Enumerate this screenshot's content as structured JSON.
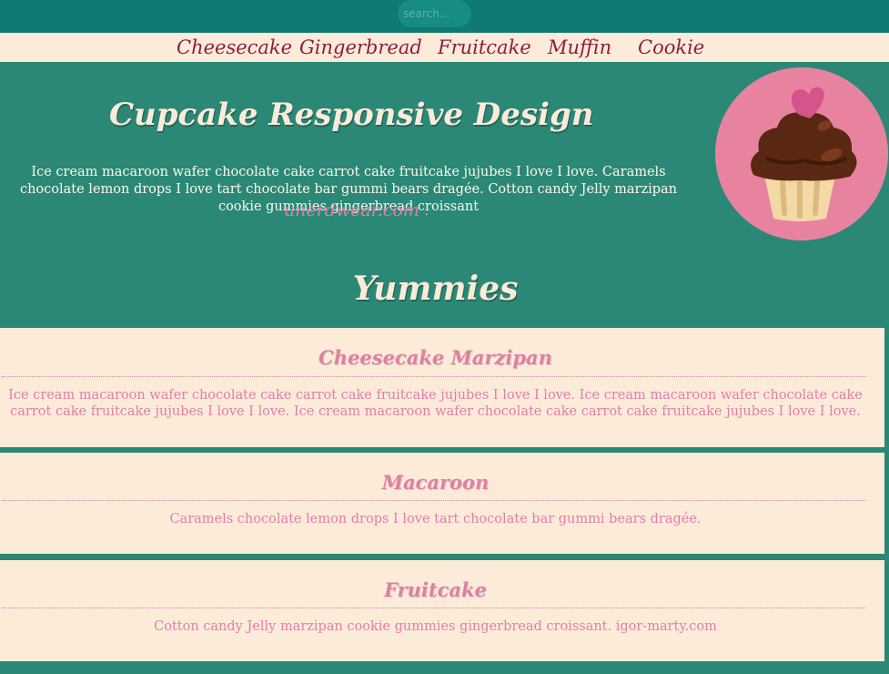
{
  "search": {
    "placeholder": "search..."
  },
  "nav": {
    "items": [
      "Cheesecake",
      "Gingerbread",
      "Fruitcake",
      "Muffin",
      "Cookie"
    ]
  },
  "hero": {
    "title": "Cupcake Responsive Design",
    "text": "Ice cream macaroon wafer chocolate cake carrot cake fruitcake jujubes I love I love. Caramels chocolate lemon drops I love tart chocolate bar gummi bears dragée. Cotton candy Jelly marzipan cookie gummies gingerbread croissant",
    "link": "unerdwear.com",
    "trailing": "."
  },
  "section": {
    "title": "Yummies"
  },
  "cards": [
    {
      "title": "Cheesecake Marzipan",
      "text": "Ice cream macaroon wafer chocolate cake carrot cake fruitcake jujubes I love I love. Ice cream macaroon wafer chocolate cake carrot cake fruitcake jujubes I love I love. Ice cream macaroon wafer chocolate cake carrot cake fruitcake jujubes I love I love."
    },
    {
      "title": "Macaroon",
      "text": "Caramels chocolate lemon drops I love tart chocolate bar gummi bears dragée."
    },
    {
      "title": "Fruitcake",
      "text": "Cotton candy Jelly marzipan cookie gummies gingerbread croissant. igor-marty.com"
    }
  ],
  "colors": {
    "background": "#2b8877",
    "topbar": "#0e7a72",
    "cream": "#fdebd9",
    "nav_text": "#8c1e3c",
    "pink": "#e07fa6"
  },
  "icons": {
    "hero_image": "cupcake-icon"
  }
}
